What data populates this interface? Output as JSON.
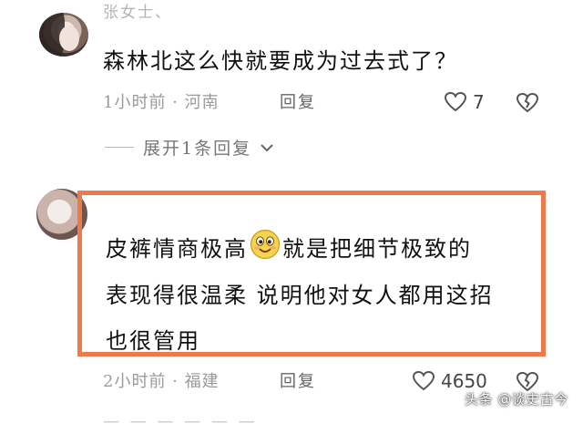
{
  "comment1": {
    "author": "张女士、",
    "text": "森林北这么快就要成为过去式了？",
    "meta": "1小时前 · 河南",
    "reply_label": "回复",
    "like_count": "7",
    "expand_replies_label": "展开1条回复"
  },
  "comment2": {
    "text_part1": "皮裤情商极高",
    "text_part2": "就是把细节极致的",
    "text_line2": "表现得很温柔 说明他对女人都用这招",
    "text_line3": "也很管用",
    "meta": "2小时前 · 福建",
    "reply_label": "回复",
    "like_count": "4650",
    "highlight_color": "#ec7a4a"
  },
  "next_comment_peek": "一 一 一 一 一 一",
  "watermark": "头条 @谈史古今",
  "icons": [
    "avatar",
    "heart-icon",
    "broken-heart-icon",
    "chevron-down-icon",
    "smile-emoji-icon"
  ]
}
